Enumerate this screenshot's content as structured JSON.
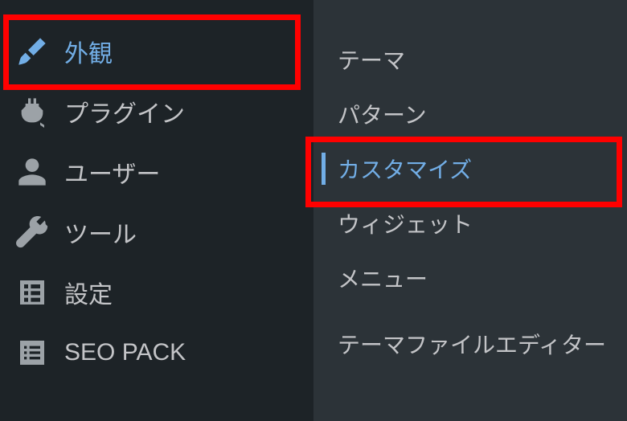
{
  "sidebar": {
    "items": [
      {
        "label": "外観",
        "icon": "paintbrush-icon"
      },
      {
        "label": "プラグイン",
        "icon": "plugin-icon"
      },
      {
        "label": "ユーザー",
        "icon": "user-icon"
      },
      {
        "label": "ツール",
        "icon": "wrench-icon"
      },
      {
        "label": "設定",
        "icon": "settings-icon"
      },
      {
        "label": "SEO PACK",
        "icon": "list-icon"
      }
    ],
    "active_index": 0
  },
  "submenu": {
    "items": [
      {
        "label": "テーマ"
      },
      {
        "label": "パターン"
      },
      {
        "label": "カスタマイズ"
      },
      {
        "label": "ウィジェット"
      },
      {
        "label": "メニュー"
      },
      {
        "label": "テーマファイルエディター"
      }
    ],
    "active_index": 2
  },
  "colors": {
    "sidebar_bg": "#1d2327",
    "submenu_bg": "#2c3338",
    "active_text": "#72aee6",
    "normal_text": "#c3c4c7",
    "highlight_border": "#ff0000"
  }
}
